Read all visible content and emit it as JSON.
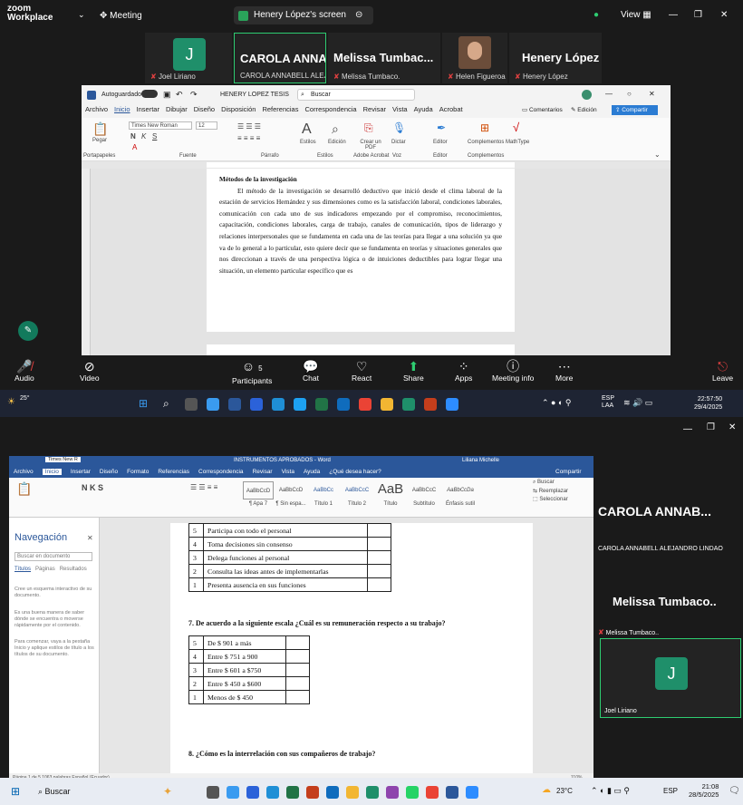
{
  "zoom": {
    "logo_line1": "zoom",
    "logo_line2": "Workplace",
    "meeting_label": "Meeting",
    "screen_title": "Henery López's screen",
    "view_label": "View",
    "tiles": [
      {
        "letter": "J",
        "label": "Joel Liriano"
      },
      {
        "name": "CAROLA ANNA...",
        "label": "CAROLA ANNABELL ALEJ..."
      },
      {
        "name": "Melissa Tumbac...",
        "label": "Melissa Tumbaco."
      },
      {
        "label": "Helen Figueroa"
      },
      {
        "name": "Henery López",
        "label": "Henery López"
      }
    ],
    "toolbar": {
      "audio": "Audio",
      "video": "Video",
      "participants": "Participants",
      "participants_count": "5",
      "chat": "Chat",
      "react": "React",
      "share": "Share",
      "apps": "Apps",
      "meeting_info": "Meeting info",
      "more": "More",
      "leave": "Leave"
    }
  },
  "word1": {
    "autosave": "Autoguardado",
    "doc_title": "HENERY LOPEZ TESIS",
    "search": "Buscar",
    "tabs": [
      "Archivo",
      "Inicio",
      "Insertar",
      "Dibujar",
      "Diseño",
      "Disposición",
      "Referencias",
      "Correspondencia",
      "Revisar",
      "Vista",
      "Ayuda",
      "Acrobat"
    ],
    "comments": "Comentarios",
    "edit_mode": "Edición",
    "share": "Compartir",
    "ribbon": {
      "paste": "Pegar",
      "font": "Times New Roman",
      "size": "12",
      "styles": "Estilos",
      "editing": "Edición",
      "create_pdf": "Crear un PDF",
      "dictate": "Dictar",
      "editor": "Editor",
      "addins": "Complementos",
      "mathtype": "MathType",
      "groups": [
        "Portapapeles",
        "Fuente",
        "Párrafo",
        "Estilos",
        "Adobe Acrobat",
        "Voz",
        "Editor",
        "Complementos"
      ]
    },
    "heading": "Métodos de la investigación",
    "paragraph": "El método de la investigación se desarrolló deductivo que inició desde el clima laboral de la estación de servicios Hernández y sus dimensiones como es la satisfacción laboral, condiciones laborales, comunicación con cada uno de sus indicadores empezando por el compromiso, reconocimientos, capacitación, condiciones laborales, carga de trabajo, canales de comunicación, tipos de liderazgo y relaciones interpersonales que se fundamenta en cada una de las teorías para llegar a una solución ya que va de lo general a lo particular, esto quiere decir que se fundamenta en teorías y situaciones generales que nos direccionan a través de una perspectiva lógica o de intuiciones deductibles para lograr llegar una situación, un elemento particular específico que es"
  },
  "taskbar1": {
    "temp": "25°",
    "lang1": "ESP",
    "lang2": "LAA",
    "time": "22:57:50",
    "date": "29/4/2025"
  },
  "word2": {
    "font": "Times New R",
    "doc_title": "INSTRUMENTOS APROBADOS - Word",
    "user": "Liliana Michelle",
    "tabs": [
      "Archivo",
      "Inicio",
      "Insertar",
      "Diseño",
      "Formato",
      "Referencias",
      "Correspondencia",
      "Revisar",
      "Vista",
      "Ayuda",
      "¿Qué desea hacer?"
    ],
    "share": "Compartir",
    "styles": [
      "AaBbCcD",
      "AaBbCcD",
      "AaBbCc",
      "AaBbCcC",
      "AaB",
      "AaBbCcC",
      "AaBbCcDa"
    ],
    "style_names": [
      "¶ Apa 7",
      "¶ Sin espa...",
      "Título 1",
      "Título 2",
      "Título",
      "Subtítulo",
      "Énfasis sutil"
    ],
    "buscar": "Buscar",
    "reemplazar": "Reemplazar",
    "seleccionar": "Seleccionar",
    "nav": {
      "title": "Navegación",
      "search": "Buscar en documento",
      "tabs": [
        "Títulos",
        "Páginas",
        "Resultados"
      ],
      "p1": "Cree un esquema interactivo de su documento.",
      "p2": "Es una buena manera de saber dónde se encuentra o moverse rápidamente por el contenido.",
      "p3": "Para comenzar, vaya a la pestaña Inicio y aplique estilos de título a los títulos de su documento."
    },
    "table1": [
      {
        "n": "5",
        "t": "Participa con todo el personal"
      },
      {
        "n": "4",
        "t": "Toma decisiones sin consenso"
      },
      {
        "n": "3",
        "t": "Delega funciones al personal"
      },
      {
        "n": "2",
        "t": "Consulta las ideas antes de implementarlas"
      },
      {
        "n": "1",
        "t": "Presenta ausencia en sus funciones"
      }
    ],
    "q7": "7. De acuerdo a la siguiente escala ¿Cuál es su remuneración respecto a su trabajo?",
    "table2": [
      {
        "n": "5",
        "t": "De $ 901 a más"
      },
      {
        "n": "4",
        "t": "Entre $ 751 a 900"
      },
      {
        "n": "3",
        "t": "Entre $ 601 a $750"
      },
      {
        "n": "2",
        "t": "Entre $ 450 a $600"
      },
      {
        "n": "1",
        "t": "Menos de $ 450"
      }
    ],
    "q8": "8. ¿Cómo es la interrelación con sus compañeros de trabajo?",
    "status": "Página 1 de 5   1063 palabras   Español (Ecuador)",
    "zoom": "110%"
  },
  "side": {
    "name1": "CAROLA ANNAB...",
    "label1": "CAROLA ANNABELL ALEJANDRO LINDAO",
    "name2": "Melissa Tumbaco..",
    "label2": "Melissa Tumbaco..",
    "letter": "J",
    "label3": "Joel Liriano"
  },
  "taskbar2": {
    "search": "Buscar",
    "temp": "23°C",
    "lang": "ESP",
    "time": "21:08",
    "date": "28/5/2025"
  }
}
